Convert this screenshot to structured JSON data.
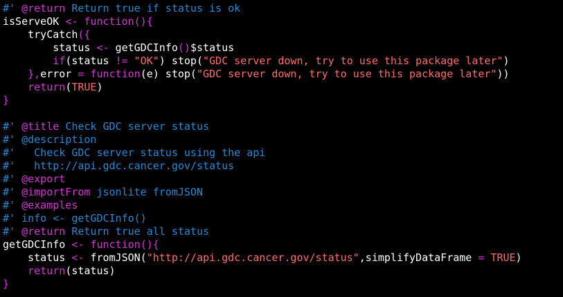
{
  "colors": {
    "background": "#000000",
    "plain": "#ffffff",
    "comment": "#1f8ad6",
    "keyword": "#d633d6",
    "string": "#ff6a6a",
    "identifier": "#ffffff"
  },
  "code_lines": [
    [
      [
        "c",
        "#' "
      ],
      [
        "k",
        "@return"
      ],
      [
        "c",
        " Return true if status is ok"
      ]
    ],
    [
      [
        "p",
        "isServeOK "
      ],
      [
        "k",
        "<-"
      ],
      [
        "p",
        " "
      ],
      [
        "k",
        "function"
      ],
      [
        "k",
        "(){"
      ]
    ],
    [
      [
        "p",
        "    "
      ],
      [
        "p",
        "tryCatch"
      ],
      [
        "k",
        "({"
      ]
    ],
    [
      [
        "p",
        "        "
      ],
      [
        "p",
        "status "
      ],
      [
        "k",
        "<-"
      ],
      [
        "p",
        " getGDCInfo"
      ],
      [
        "k",
        "()"
      ],
      [
        "p",
        "$status"
      ]
    ],
    [
      [
        "p",
        "        "
      ],
      [
        "k",
        "if"
      ],
      [
        "p",
        "(status "
      ],
      [
        "k",
        "!="
      ],
      [
        "p",
        " "
      ],
      [
        "s",
        "\"OK\""
      ],
      [
        "p",
        ") stop("
      ],
      [
        "s",
        "\"GDC server down, try to use this package later\""
      ],
      [
        "p",
        ")"
      ]
    ],
    [
      [
        "p",
        "    "
      ],
      [
        "k",
        "},"
      ],
      [
        "p",
        "error "
      ],
      [
        "k",
        "="
      ],
      [
        "p",
        " "
      ],
      [
        "k",
        "function"
      ],
      [
        "p",
        "(e) stop("
      ],
      [
        "s",
        "\"GDC server down, try to use this package later\""
      ],
      [
        "p",
        "))"
      ]
    ],
    [
      [
        "p",
        "    "
      ],
      [
        "k",
        "return"
      ],
      [
        "p",
        "("
      ],
      [
        "s",
        "TRUE"
      ],
      [
        "p",
        ")"
      ]
    ],
    [
      [
        "k",
        "}"
      ]
    ],
    [],
    [
      [
        "c",
        "#' "
      ],
      [
        "k",
        "@title"
      ],
      [
        "c",
        " Check GDC server status"
      ]
    ],
    [
      [
        "c",
        "#' @description"
      ]
    ],
    [
      [
        "c",
        "#'   Check GDC server status using the api"
      ]
    ],
    [
      [
        "c",
        "#'   http://api.gdc.cancer.gov/status"
      ]
    ],
    [
      [
        "c",
        "#' "
      ],
      [
        "k",
        "@export"
      ]
    ],
    [
      [
        "c",
        "#' "
      ],
      [
        "k",
        "@importFrom"
      ],
      [
        "c",
        " jsonlite fromJSON"
      ]
    ],
    [
      [
        "c",
        "#' "
      ],
      [
        "k",
        "@examples"
      ]
    ],
    [
      [
        "c",
        "#' info <- getGDCInfo()"
      ]
    ],
    [
      [
        "c",
        "#' "
      ],
      [
        "k",
        "@return"
      ],
      [
        "c",
        " Return true all status"
      ]
    ],
    [
      [
        "p",
        "getGDCInfo "
      ],
      [
        "k",
        "<-"
      ],
      [
        "p",
        " "
      ],
      [
        "k",
        "function"
      ],
      [
        "k",
        "(){"
      ]
    ],
    [
      [
        "p",
        "    status "
      ],
      [
        "k",
        "<-"
      ],
      [
        "p",
        " fromJSON("
      ],
      [
        "s",
        "\"http://api.gdc.cancer.gov/status\""
      ],
      [
        "p",
        ",simplifyDataFrame "
      ],
      [
        "k",
        "="
      ],
      [
        "p",
        " "
      ],
      [
        "s",
        "TRUE"
      ],
      [
        "p",
        ")"
      ]
    ],
    [
      [
        "p",
        "    "
      ],
      [
        "k",
        "return"
      ],
      [
        "p",
        "(status)"
      ]
    ],
    [
      [
        "k",
        "}"
      ]
    ]
  ]
}
